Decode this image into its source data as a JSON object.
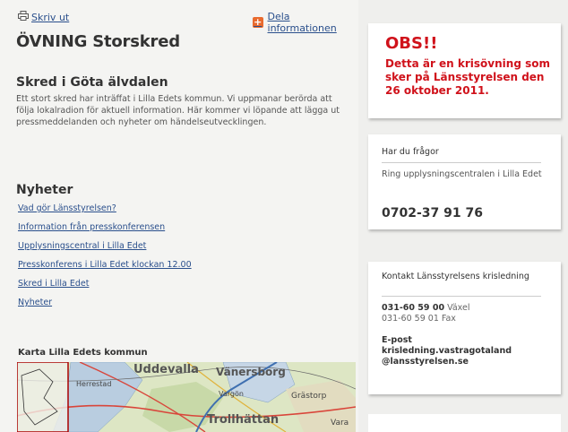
{
  "toolbar": {
    "print_label": "Skriv ut",
    "share_label": "Dela informationen"
  },
  "page": {
    "title": "ÖVNING Storskred",
    "subtitle": "Skred i Göta älvdalen",
    "intro": "Ett stort skred har inträffat i Lilla Edets kommun. Vi uppmanar berörda att följa lokalradion för aktuell information. Här kommer vi löpande att lägga ut pressmeddelanden och nyheter om händelseutvecklingen."
  },
  "news": {
    "heading": "Nyheter",
    "links": [
      "Vad gör Länsstyrelsen?",
      "Information från presskonferensen",
      "Upplysningscentral i Lilla Edet",
      "Presskonferens i Lilla Edet klockan 12.00",
      "Skred i Lilla Edet",
      "Nyheter"
    ]
  },
  "map": {
    "title": "Karta Lilla Edets kommun",
    "places": [
      "Uddevalla",
      "Vänersborg",
      "Herrestad",
      "Vargön",
      "Grästorp",
      "Trollhättan",
      "Vara"
    ]
  },
  "obs": {
    "heading": "OBS!!",
    "text": "Detta är en krisövning som sker på Länsstyrelsen den 26 oktober 2011."
  },
  "questions": {
    "heading": "Har du frågor",
    "text": "Ring upplysningscentralen i Lilla Edet",
    "phone": "0702-37 91 76"
  },
  "contact": {
    "heading": "Kontakt Länsstyrelsens krisledning",
    "phone_main": "031-60 59 00",
    "phone_main_label": "Växel",
    "fax": "031-60 59 01 Fax",
    "email_label": "E-post",
    "email_line1": "krisledning.vastragotaland",
    "email_line2": "@lansstyrelsen.se"
  },
  "colors": {
    "alert_red": "#d0121b",
    "link_blue": "#2a4f8c",
    "share_orange": "#e96a2e"
  },
  "icons": {
    "print": "printer-icon",
    "share": "plus-icon"
  }
}
